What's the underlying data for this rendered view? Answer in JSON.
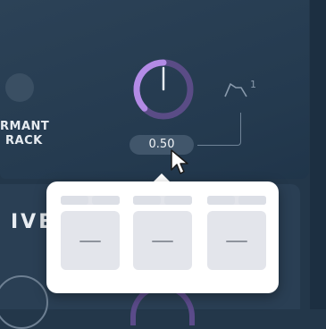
{
  "formant": {
    "label_line1": "RMANT",
    "label_line2": "RACK",
    "knob_value": 0.5,
    "value_display": "0.50"
  },
  "modulation": {
    "wave_icon": "envelope-wave-icon",
    "badge": "1"
  },
  "section": {
    "label": "IVE"
  },
  "popup": {
    "slots": [
      {
        "value": "—"
      },
      {
        "value": "—"
      },
      {
        "value": "—"
      }
    ]
  },
  "colors": {
    "knob_accent": "#b38be6",
    "knob_track": "#5a4c86",
    "background": "#23374a",
    "popup_bg": "#ffffff"
  }
}
